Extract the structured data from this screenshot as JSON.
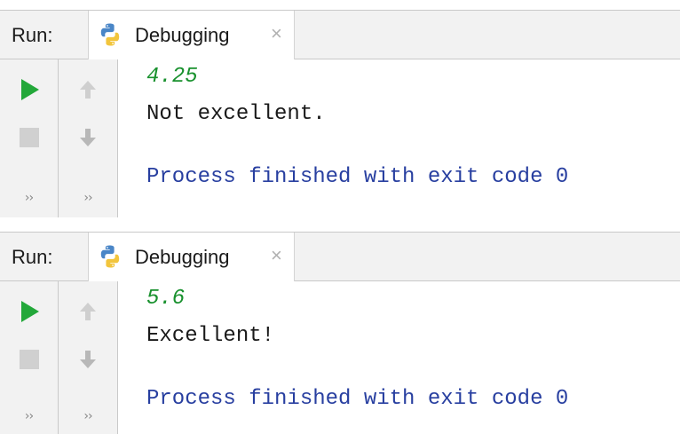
{
  "colors": {
    "play": "#23a83a",
    "user_input": "#19912e",
    "process_text": "#283fa0",
    "toolbar_bg": "#f2f2f2"
  },
  "panels": [
    {
      "run_label": "Run:",
      "tab": {
        "icon": "python-icon",
        "label": "Debugging",
        "close": "×"
      },
      "toolbar_left": [
        "play-icon",
        "stop-icon",
        "more-icon"
      ],
      "toolbar_right": [
        "arrow-up-icon",
        "arrow-down-icon",
        "more-icon"
      ],
      "more_glyph": "››",
      "console": {
        "input": "4.25",
        "output": "Not excellent.",
        "process": "Process finished with exit code 0"
      }
    },
    {
      "run_label": "Run:",
      "tab": {
        "icon": "python-icon",
        "label": "Debugging",
        "close": "×"
      },
      "toolbar_left": [
        "play-icon",
        "stop-icon",
        "more-icon"
      ],
      "toolbar_right": [
        "arrow-up-icon",
        "arrow-down-icon",
        "more-icon"
      ],
      "more_glyph": "››",
      "console": {
        "input": "5.6",
        "output": "Excellent!",
        "process": "Process finished with exit code 0"
      }
    }
  ]
}
